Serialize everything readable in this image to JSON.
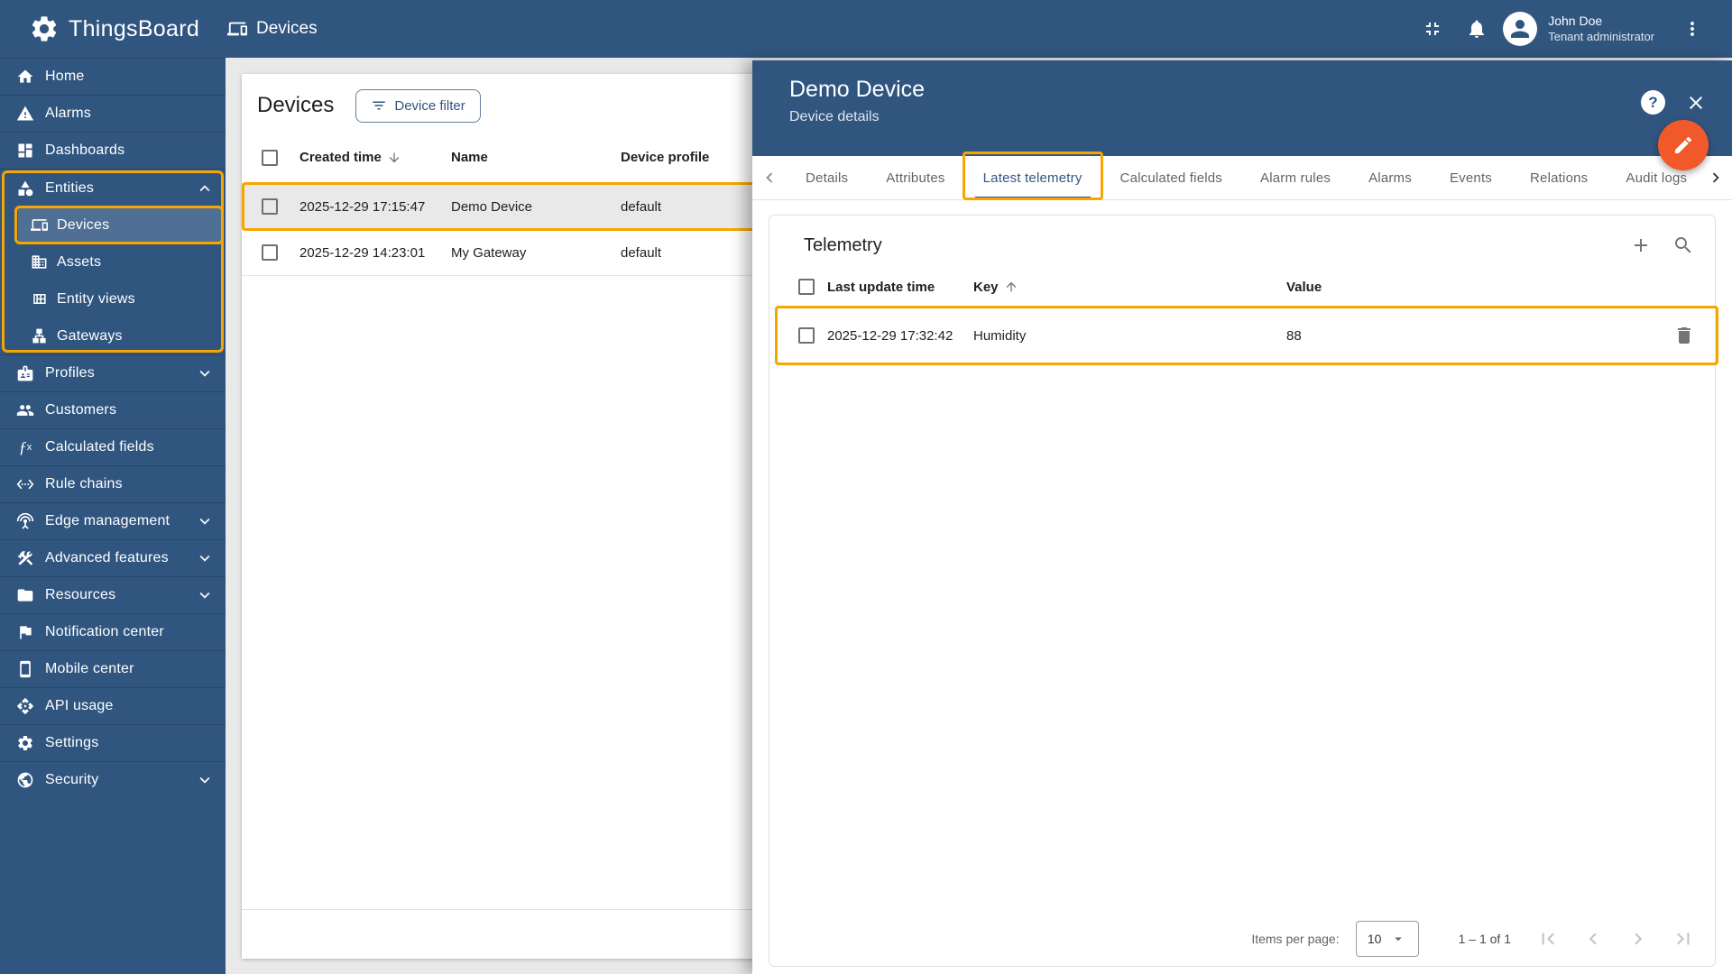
{
  "colors": {
    "primary": "#305680",
    "selected_sidebar_bg": "#4f6f94",
    "annotation": "#f7a600",
    "fab": "#f1592a",
    "row_highlight": "#e9e9e9"
  },
  "header": {
    "app_name": "ThingsBoard",
    "page_title": "Devices",
    "user": {
      "name": "John Doe",
      "role": "Tenant administrator"
    }
  },
  "sidebar": {
    "items": [
      {
        "label": "Home",
        "icon": "home"
      },
      {
        "label": "Alarms",
        "icon": "alarms"
      },
      {
        "label": "Dashboards",
        "icon": "dashboards"
      },
      {
        "label": "Entities",
        "icon": "entities",
        "expand": "up",
        "group_annotated": true,
        "children": [
          {
            "label": "Devices",
            "icon": "devices",
            "selected": true,
            "annotated": true
          },
          {
            "label": "Assets",
            "icon": "assets"
          },
          {
            "label": "Entity views",
            "icon": "entity-views"
          },
          {
            "label": "Gateways",
            "icon": "gateways"
          }
        ]
      },
      {
        "label": "Profiles",
        "icon": "profiles",
        "expand": "down"
      },
      {
        "label": "Customers",
        "icon": "customers"
      },
      {
        "label": "Calculated fields",
        "icon": "fx"
      },
      {
        "label": "Rule chains",
        "icon": "rule-chains"
      },
      {
        "label": "Edge management",
        "icon": "edge",
        "expand": "down"
      },
      {
        "label": "Advanced features",
        "icon": "tools",
        "expand": "down"
      },
      {
        "label": "Resources",
        "icon": "folder",
        "expand": "down"
      },
      {
        "label": "Notification center",
        "icon": "flag"
      },
      {
        "label": "Mobile center",
        "icon": "phone"
      },
      {
        "label": "API usage",
        "icon": "api"
      },
      {
        "label": "Settings",
        "icon": "gear"
      },
      {
        "label": "Security",
        "icon": "security",
        "expand": "down"
      }
    ]
  },
  "devices_panel": {
    "title": "Devices",
    "filter_button": "Device filter",
    "columns": {
      "created": "Created time",
      "name": "Name",
      "profile": "Device profile"
    },
    "rows": [
      {
        "created": "2025-12-29 17:15:47",
        "name": "Demo Device",
        "profile": "default",
        "highlighted": true
      },
      {
        "created": "2025-12-29 14:23:01",
        "name": "My Gateway",
        "profile": "default",
        "highlighted": false
      }
    ]
  },
  "details_panel": {
    "title": "Demo Device",
    "subtitle": "Device details",
    "help_label": "?",
    "tabs": [
      {
        "label": "Details"
      },
      {
        "label": "Attributes"
      },
      {
        "label": "Latest telemetry",
        "active": true,
        "annotated": true
      },
      {
        "label": "Calculated fields"
      },
      {
        "label": "Alarm rules"
      },
      {
        "label": "Alarms"
      },
      {
        "label": "Events"
      },
      {
        "label": "Relations"
      },
      {
        "label": "Audit logs"
      }
    ],
    "telemetry": {
      "title": "Telemetry",
      "columns": {
        "time": "Last update time",
        "key": "Key",
        "value": "Value"
      },
      "rows": [
        {
          "time": "2025-12-29 17:32:42",
          "key": "Humidity",
          "value": "88",
          "annotated": true
        }
      ],
      "pagination": {
        "items_per_page_label": "Items per page:",
        "page_size": "10",
        "range_label": "1 – 1 of 1"
      }
    }
  }
}
